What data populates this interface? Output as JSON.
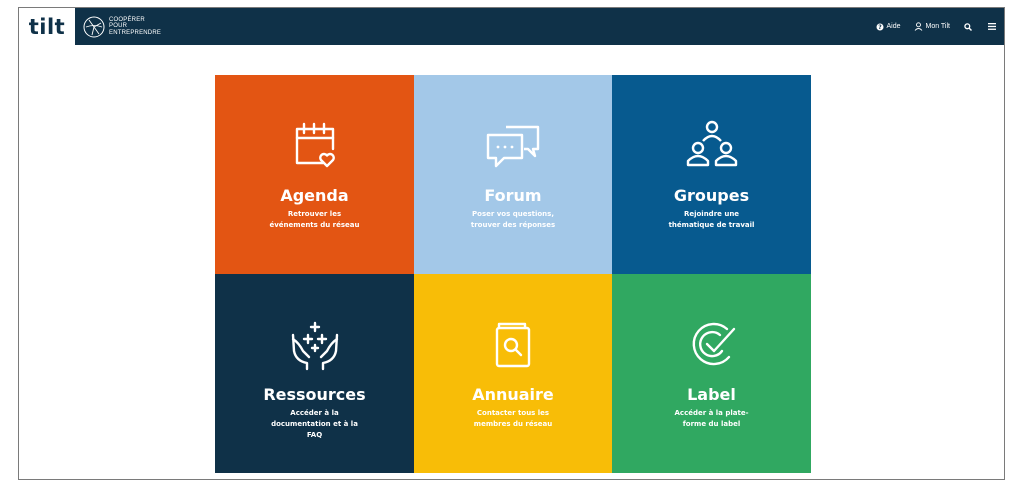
{
  "brand": {
    "logo": "tilt",
    "partner_logo": "COOPÉRER POUR ENTREPRENDRE"
  },
  "nav": {
    "help": "Aide",
    "account": "Mon Tilt",
    "icons": [
      "help-circle-icon",
      "user-icon",
      "search-icon",
      "menu-icon"
    ]
  },
  "tiles": [
    {
      "title": "Agenda",
      "subtitle": "Retrouver les\névénements du réseau",
      "icon": "calendar-heart-icon",
      "color": "#e35513"
    },
    {
      "title": "Forum",
      "subtitle": "Poser vos questions,\ntrouver des réponses",
      "icon": "chat-bubbles-icon",
      "color": "#a3c8e8"
    },
    {
      "title": "Groupes",
      "subtitle": "Rejoindre une\nthématique de travail",
      "icon": "people-group-icon",
      "color": "#075a8f"
    },
    {
      "title": "Ressources",
      "subtitle": "Accéder à la\ndocumentation et à la\nFAQ",
      "icon": "hands-sparkle-icon",
      "color": "#0f3148"
    },
    {
      "title": "Annuaire",
      "subtitle": "Contacter tous les\nmembres du réseau",
      "icon": "directory-search-icon",
      "color": "#f8bd07"
    },
    {
      "title": "Label",
      "subtitle": "Accéder à la plate-\nforme du label",
      "icon": "label-check-icon",
      "color": "#30a861"
    }
  ]
}
